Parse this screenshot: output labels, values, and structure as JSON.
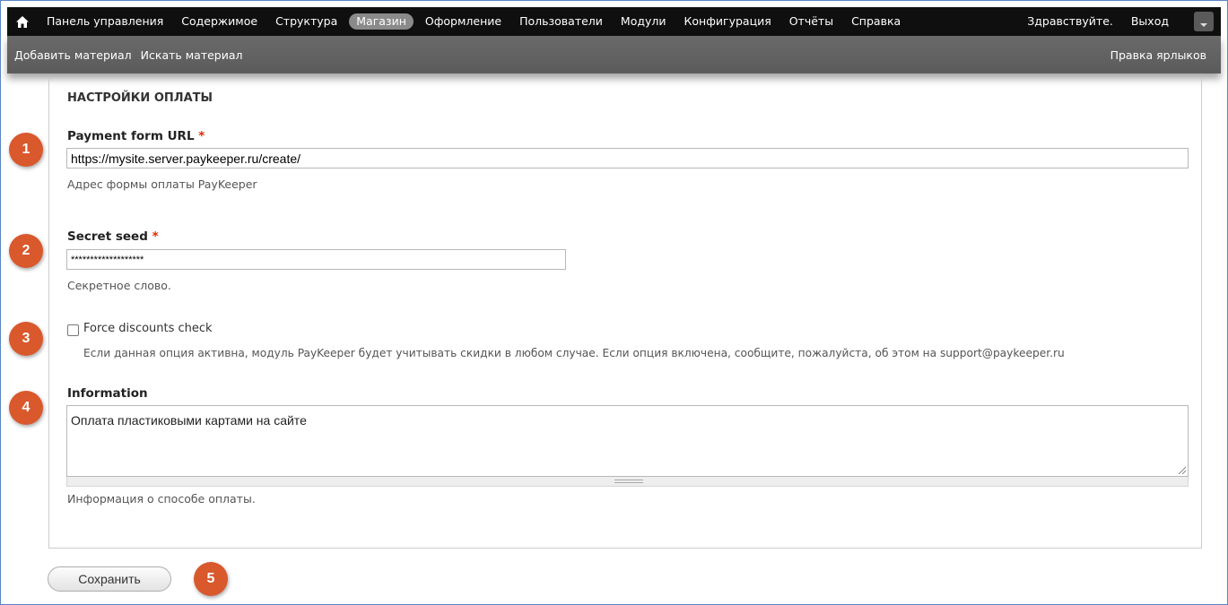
{
  "toolbar": {
    "items": [
      "Панель управления",
      "Содержимое",
      "Структура",
      "Магазин",
      "Оформление",
      "Пользователи",
      "Модули",
      "Конфигурация",
      "Отчёты",
      "Справка"
    ],
    "active": "Магазин",
    "greeting": "Здравствуйте.",
    "logout": "Выход"
  },
  "shortcuts": {
    "add": "Добавить материал",
    "search": "Искать материал",
    "edit": "Правка ярлыков"
  },
  "fieldset": {
    "legend": "НАСТРОЙКИ ОПЛАТЫ"
  },
  "fields": {
    "url": {
      "label": "Payment form URL",
      "required": "*",
      "value": "https://mysite.server.paykeeper.ru/create/",
      "description": "Адрес формы оплаты PayKeeper"
    },
    "secret": {
      "label": "Secret seed",
      "required": "*",
      "value": "*******************",
      "description": "Секретное слово."
    },
    "discounts": {
      "label": "Force discounts check",
      "checked": false,
      "description": "Если данная опция активна, модуль PayKeeper будет учитывать скидки в любом случае. Если опция включена, сообщите, пожалуйста, об этом на support@paykeeper.ru"
    },
    "information": {
      "label": "Information",
      "value": "Оплата пластиковыми картами на сайте",
      "description": "Информация о способе оплаты."
    }
  },
  "actions": {
    "save": "Сохранить"
  },
  "badges": [
    "1",
    "2",
    "3",
    "4",
    "5"
  ],
  "colors": {
    "badge": "#d9582c",
    "required": "#e32700",
    "toolbar": "#0f0f0f",
    "shortcuts": "#606060"
  }
}
